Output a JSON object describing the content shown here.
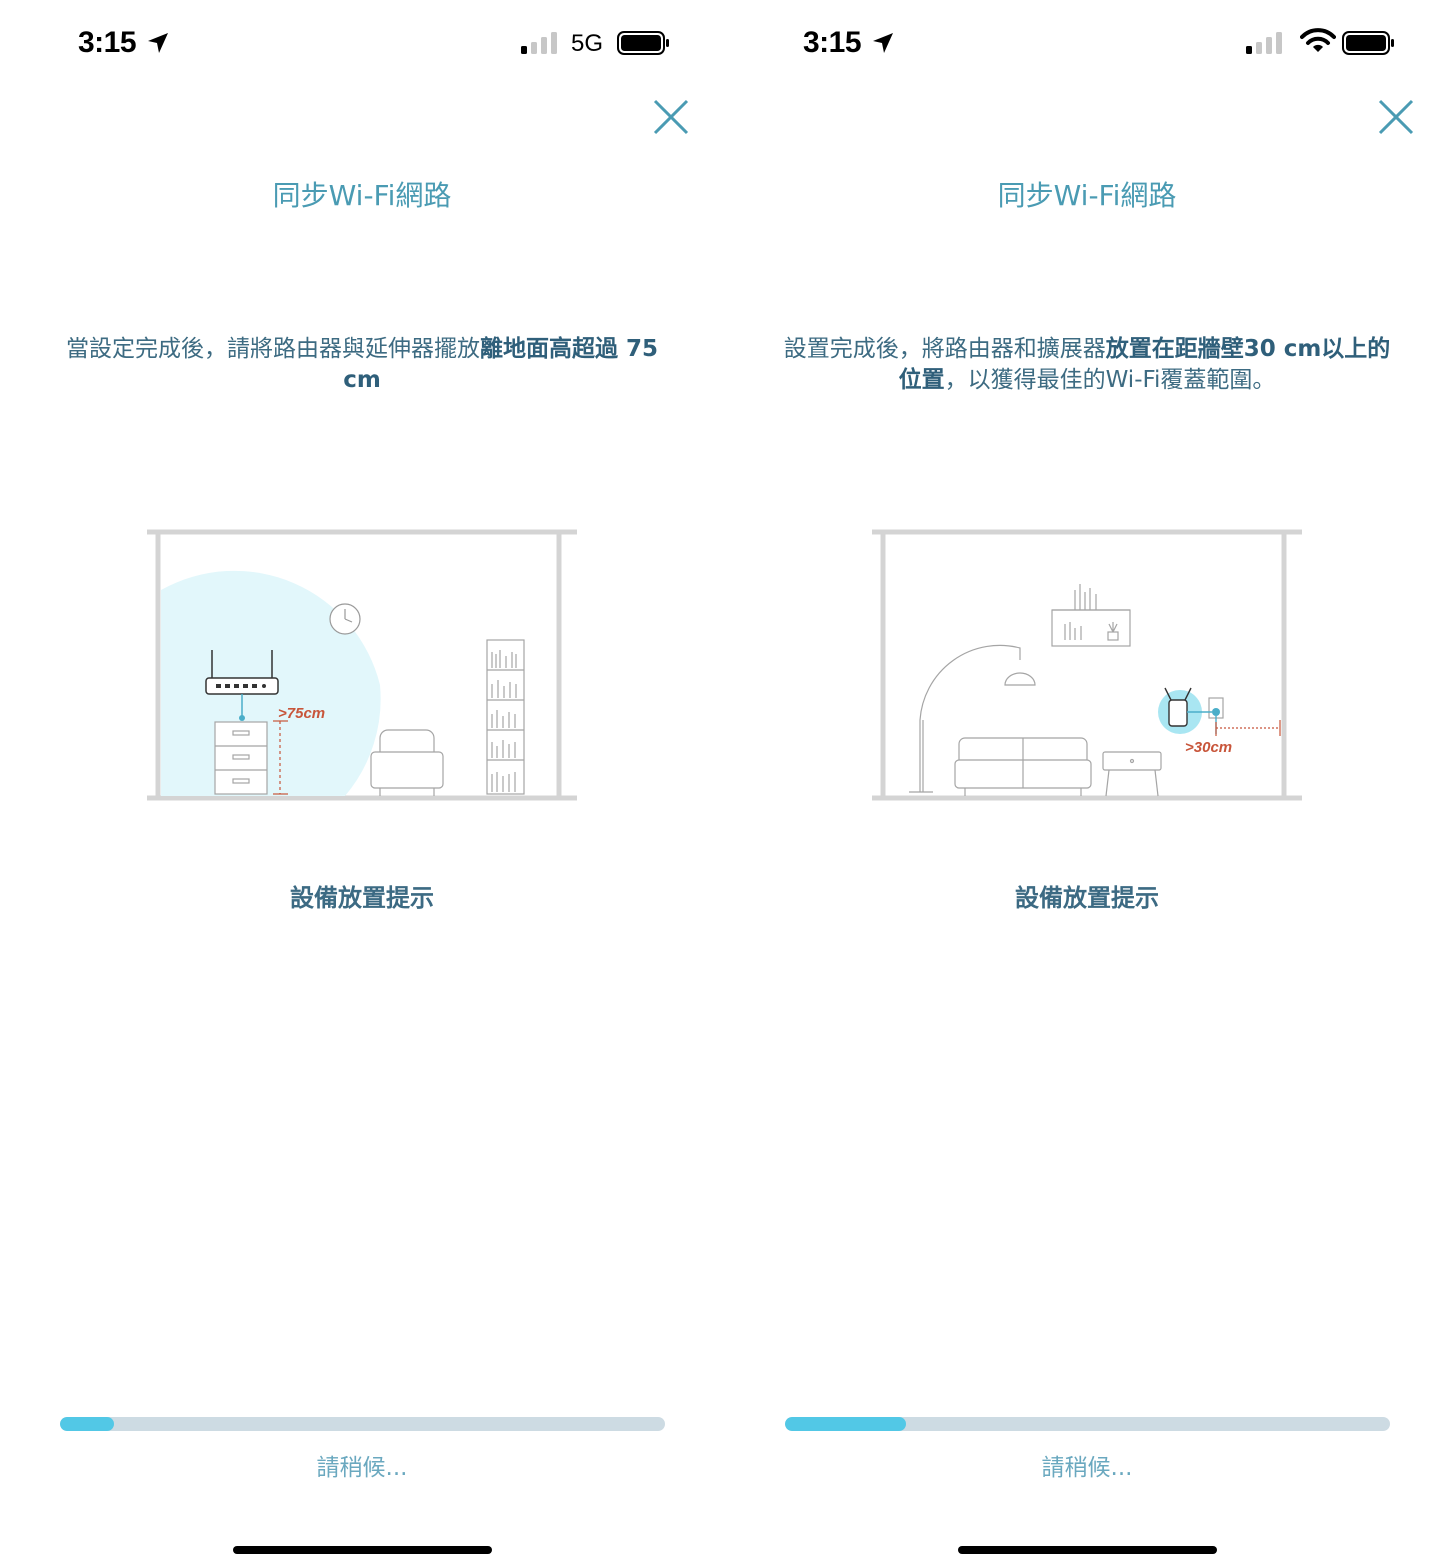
{
  "screens": [
    {
      "status_bar": {
        "time": "3:15",
        "network": "5G",
        "signal_icon": "cellular-signal-icon",
        "connectivity_icon": "none",
        "battery_icon": "battery-icon"
      },
      "title": "同步Wi-Fi網路",
      "description_prefix": "當設定完成後，請將路由器與延伸器擺放",
      "description_bold": "離地面高超過 75 cm",
      "description_suffix": "",
      "illustration_label": ">75cm",
      "hint_title": "設備放置提示",
      "progress": 0.09,
      "status_text": "請稍候..."
    },
    {
      "status_bar": {
        "time": "3:15",
        "network": "",
        "signal_icon": "cellular-signal-icon",
        "connectivity_icon": "wifi-icon",
        "battery_icon": "battery-icon"
      },
      "title": "同步Wi-Fi網路",
      "description_prefix": "設置完成後，將路由器和擴展器",
      "description_bold": "放置在距牆壁30 cm以上的位置",
      "description_suffix": "，以獲得最佳的Wi-Fi覆蓋範圍。",
      "illustration_label": ">30cm",
      "hint_title": "設備放置提示",
      "progress": 0.2,
      "status_text": "請稍候..."
    }
  ],
  "colors": {
    "title": "#4a9bb3",
    "description": "#3d6b82",
    "accent_label": "#c8553a",
    "progress_fill": "#52c8e6",
    "progress_track": "#cddbe3",
    "coverage": "#e2f7fb"
  }
}
